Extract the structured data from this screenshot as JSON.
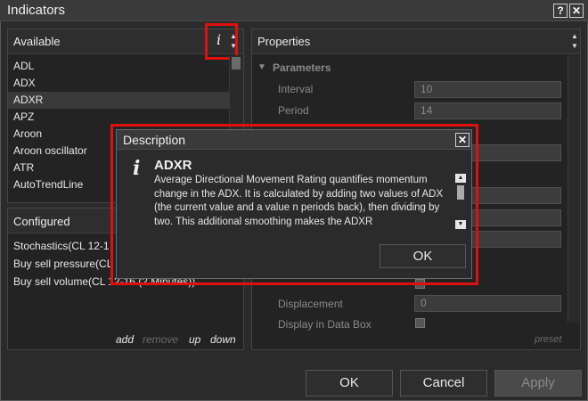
{
  "window": {
    "title": "Indicators",
    "help_glyph": "?",
    "close_glyph": "✕"
  },
  "available": {
    "title": "Available",
    "info_glyph": "i",
    "items": [
      {
        "label": "ADL"
      },
      {
        "label": "ADX"
      },
      {
        "label": "ADXR",
        "selected": true
      },
      {
        "label": "APZ"
      },
      {
        "label": "Aroon"
      },
      {
        "label": "Aroon oscillator"
      },
      {
        "label": "ATR"
      },
      {
        "label": "AutoTrendLine"
      }
    ]
  },
  "configured": {
    "title": "Configured",
    "items": [
      {
        "label": "Stochastics(CL 12-1"
      },
      {
        "label": "Buy sell pressure(CL"
      },
      {
        "label": "Buy sell volume(CL 12-16 (2 Minutes))"
      }
    ],
    "actions": {
      "add": "add",
      "remove": "remove",
      "up": "up",
      "down": "down"
    }
  },
  "properties": {
    "title": "Properties",
    "section": "Parameters",
    "interval_label": "Interval",
    "interval_value": "10",
    "period_label": "Period",
    "period_value": "14",
    "displacement_label": "Displacement",
    "displacement_value": "0",
    "display_in_data_box_label": "Display in Data Box",
    "preset_label": "preset"
  },
  "buttons": {
    "ok": "OK",
    "cancel": "Cancel",
    "apply": "Apply"
  },
  "dialog": {
    "title": "Description",
    "heading": "ADXR",
    "body": "Average Directional Movement Rating quantifies momentum change in the ADX. It is calculated by adding two values of ADX (the current value and a value n periods back), then dividing by two. This additional smoothing makes the ADXR",
    "ok": "OK",
    "info_glyph": "i",
    "close_glyph": "✕"
  },
  "colors": {
    "highlight": "#e01010",
    "background": "#2b2b2b"
  }
}
